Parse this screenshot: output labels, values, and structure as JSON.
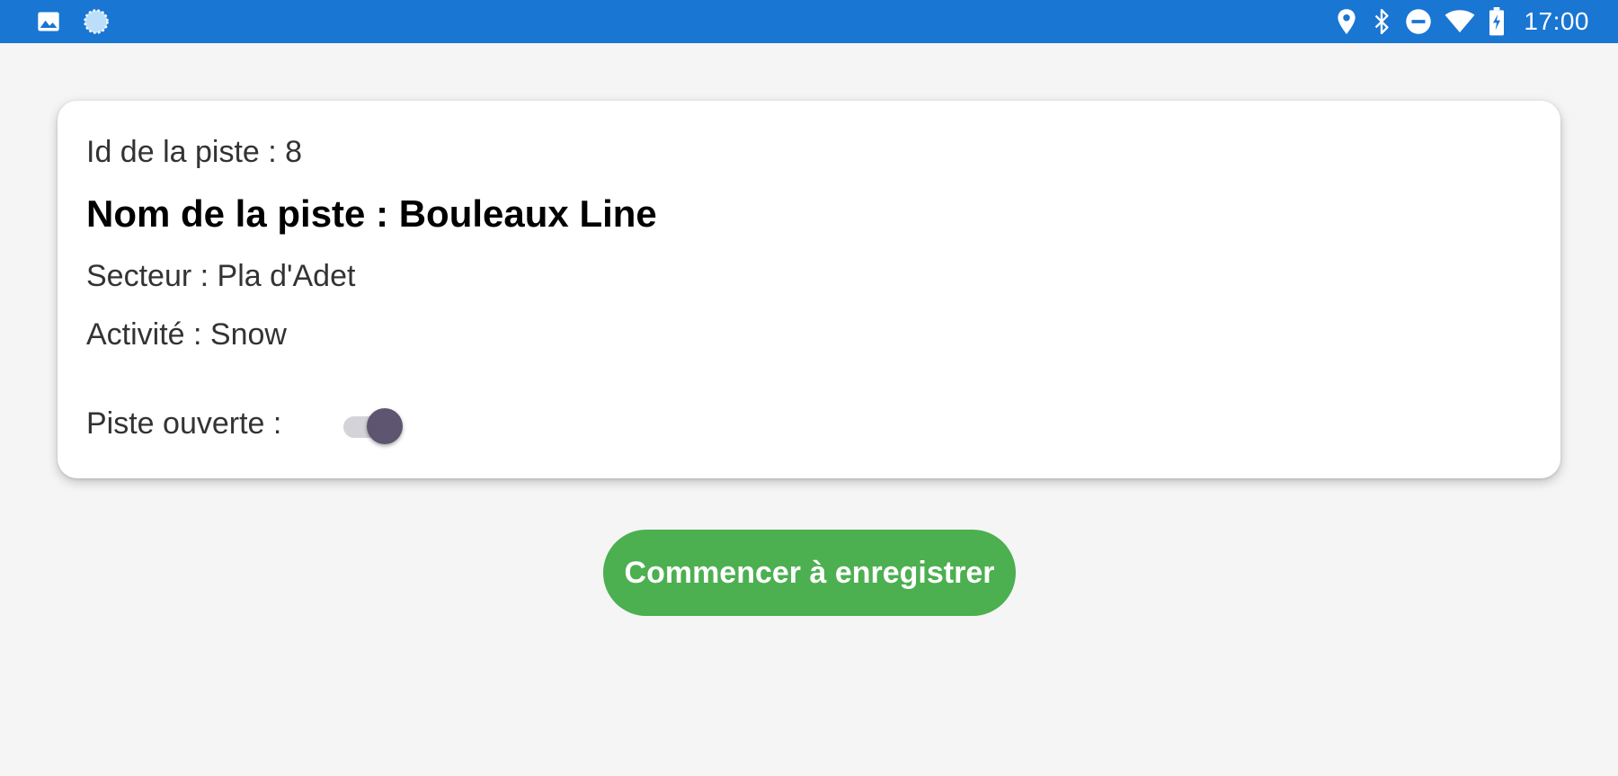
{
  "status_bar": {
    "time": "17:00",
    "left_icons": [
      "image-icon",
      "loading-icon"
    ],
    "right_icons": [
      "location-icon",
      "bluetooth-icon",
      "do-not-disturb-icon",
      "wifi-icon",
      "battery-charging-icon"
    ],
    "background": "#1976d2"
  },
  "card": {
    "id_line": "Id de la piste : 8",
    "name_line": "Nom de la piste : Bouleaux Line",
    "secteur_line": "Secteur : Pla d'Adet",
    "activite_line": "Activité : Snow",
    "open_label": "Piste ouverte :",
    "open_toggle_on": true,
    "toggle_thumb_color": "#5e5670",
    "toggle_track_color": "#d4d4d8"
  },
  "actions": {
    "record_label": "Commencer à enregistrer",
    "record_color": "#4caf50"
  }
}
